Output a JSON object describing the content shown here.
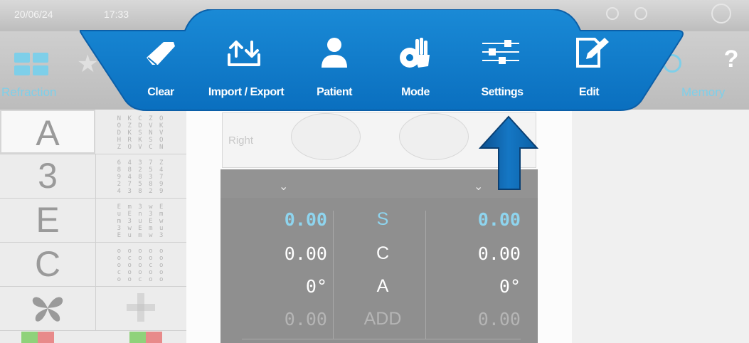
{
  "status_bar": {
    "date": "20/06/24",
    "time": "17:33"
  },
  "left_tab": {
    "label": "Refraction",
    "icon": "grid-icon"
  },
  "right_tab": {
    "label": "Memory",
    "icon": "clock-icon",
    "help": "?"
  },
  "toolbar": {
    "items": [
      {
        "label": "Clear",
        "icon": "eraser-icon"
      },
      {
        "label": "Import / Export",
        "icon": "import-export-icon"
      },
      {
        "label": "Patient",
        "icon": "person-icon"
      },
      {
        "label": "Mode",
        "icon": "hand-gear-icon"
      },
      {
        "label": "Settings",
        "icon": "sliders-icon"
      },
      {
        "label": "Edit",
        "icon": "edit-icon"
      }
    ]
  },
  "sidebar": {
    "rows": [
      {
        "symbol": "A",
        "chart": "N K C Z O\nO Z D V K\nD K S N V\nH R K S O\nZ O V C N"
      },
      {
        "symbol": "3",
        "chart": "6 4 3 7 Z\n8 8 2 5 4\n9 4 8 3 7\n2 7 5 8 9\n4 3 8 2 9"
      },
      {
        "symbol": "E",
        "chart": "E m 3 w E\nu E n 3 m\nm 3 u E w\n3 w E m u\nE u m w 3"
      },
      {
        "symbol": "C",
        "chart": "o o o o o\no c o o o\no o o c o\nc o o o o\no o c o o"
      },
      {
        "symbol": "butterfly",
        "chart": ""
      }
    ]
  },
  "eyes": {
    "right_label": "Right"
  },
  "refraction": {
    "rows": [
      {
        "left": "0.00",
        "param": "S",
        "right": "0.00",
        "highlight": true
      },
      {
        "left": "0.00",
        "param": "C",
        "right": "0.00",
        "highlight": false
      },
      {
        "left": "0°",
        "param": "A",
        "right": "0°",
        "highlight": false
      },
      {
        "left": "0.00",
        "param": "ADD",
        "right": "0.00",
        "highlight": false,
        "dim": true
      }
    ]
  },
  "colors": {
    "banner_blue": "#0a78c7",
    "accent_cyan": "#7ecfe9",
    "arrow_blue": "#0b5fa8"
  }
}
